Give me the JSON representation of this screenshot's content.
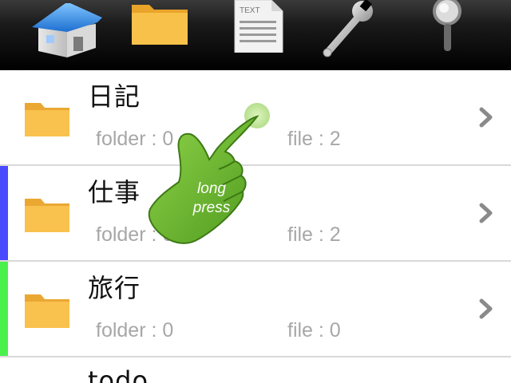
{
  "toolbar": {
    "buttons": [
      {
        "name": "home-icon"
      },
      {
        "name": "folder-icon"
      },
      {
        "name": "text-document-icon",
        "label": "TEXT"
      },
      {
        "name": "wrench-icon"
      },
      {
        "name": "magnifier-icon"
      }
    ]
  },
  "list": {
    "items": [
      {
        "title": "日記",
        "folder_text": "folder : 0",
        "file_text": "file : 2",
        "stripe_color": ""
      },
      {
        "title": "仕事",
        "folder_text": "folder : 0",
        "file_text": "file : 2",
        "stripe_color": "#4a4aff"
      },
      {
        "title": "旅行",
        "folder_text": "folder : 0",
        "file_text": "file : 0",
        "stripe_color": "#4cf04c"
      },
      {
        "title": "todo",
        "folder_text": "",
        "file_text": "",
        "stripe_color": ""
      }
    ]
  },
  "overlay": {
    "line1": "long",
    "line2": "press"
  },
  "colors": {
    "folder": "#f6b63a",
    "hand": "#6fb52c",
    "chevron": "#8a8a8a"
  }
}
